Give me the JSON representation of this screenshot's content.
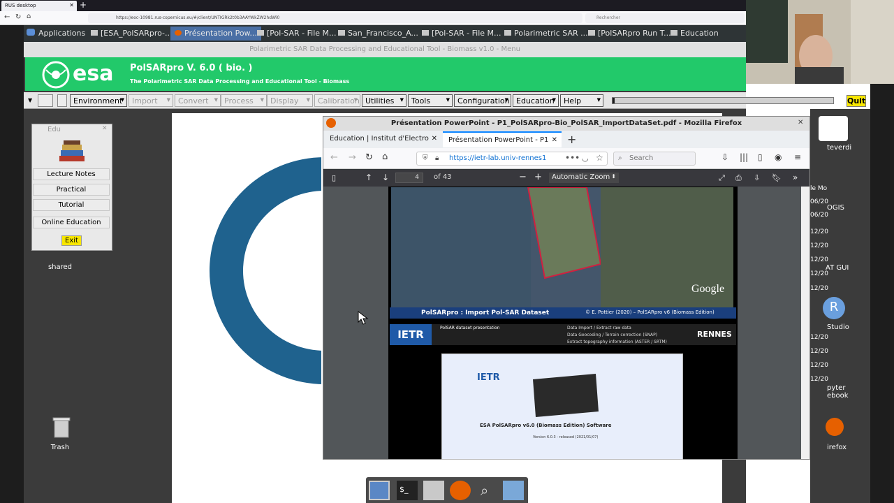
{
  "outer_browser": {
    "tab_title": "RUS desktop",
    "url": "https://eoc-10981.rus-copernicus.eu/#/client/UNTIGRk2t0b3AAYWkZW2hdWi0",
    "search_placeholder": "Rechercher"
  },
  "taskbar": {
    "applications": "Applications",
    "items": [
      {
        "label": "[ESA_PolSARpro-..."
      },
      {
        "label": "Présentation Pow..."
      },
      {
        "label": "[Pol-SAR - File M..."
      },
      {
        "label": "San_Francisco_A..."
      },
      {
        "label": "[Pol-SAR - File M..."
      },
      {
        "label": "Polarimetric SAR ..."
      },
      {
        "label": "[PolSARpro Run T..."
      },
      {
        "label": "Education"
      }
    ]
  },
  "polsar": {
    "window_title": "Polarimetric SAR Data Processing and Educational Tool - Biomass v1.0 - Menu",
    "esa_logo": "esa",
    "title": "PolSARpro V. 6.0 ( bio. )",
    "subtitle": "The Polarimetric SAR Data Processing and Educational Tool - Biomass",
    "menus": [
      {
        "label": "Environment"
      },
      {
        "label": "Import"
      },
      {
        "label": "Convert"
      },
      {
        "label": "Process"
      },
      {
        "label": "Display"
      },
      {
        "label": "Calibration"
      },
      {
        "label": "Utilities"
      },
      {
        "label": "Tools"
      },
      {
        "label": "Configuration"
      },
      {
        "label": "Education"
      },
      {
        "label": "Help"
      }
    ],
    "quit": "Quit",
    "progress": 0.01
  },
  "edu_window": {
    "title": "Edu",
    "buttons": [
      {
        "label": "Lecture Notes"
      },
      {
        "label": "Practical"
      },
      {
        "label": "Tutorial"
      },
      {
        "label": "Online Education"
      }
    ],
    "exit": "Exit"
  },
  "desktop_icons": {
    "shared": "shared",
    "trash": "Trash"
  },
  "firefox": {
    "window_title": "Présentation PowerPoint - P1_PolSARpro-Bio_PolSAR_ImportDataSet.pdf - Mozilla Firefox",
    "tabs": [
      {
        "label": "Education | Institut d'Electro"
      },
      {
        "label": "Présentation PowerPoint - P1"
      }
    ],
    "url": "https://ietr-lab.univ-rennes1",
    "search_placeholder": "Search",
    "pdf": {
      "page": "4",
      "of_pages": "of 43",
      "zoom": "Automatic Zoom",
      "slide_title": "PolSARpro : Import Pol-SAR Dataset",
      "slide_credit": "© E. Pottier (2020) – PolSARpro v6 (Biomass Edition)",
      "ietr": "IETR",
      "dataset_heading": "PolSAR dataset presentation",
      "bullets": [
        "Data Import / Extract raw data",
        "Data Geocoding / Terrain correction (SNAP)",
        "Extract topography information (ASTER / SRTM)"
      ],
      "rennes": "RENNES",
      "google": "Google",
      "software_title": "ESA PolSARpro v6.0 (Biomass Edition) Software",
      "version": "Version 6.0.3 - released (2021/01/07)"
    }
  },
  "right_strip": {
    "labels": [
      "teverdi",
      "OGIS",
      "AT GUI",
      "Studio",
      "pyter",
      "ebook",
      "irefox"
    ],
    "dates": [
      "le Mo",
      "06/20",
      "06/20",
      "12/20",
      "12/20",
      "12/20",
      "12/20",
      "12/20",
      "12/20",
      "12/20",
      "12/20",
      "12/20"
    ]
  }
}
